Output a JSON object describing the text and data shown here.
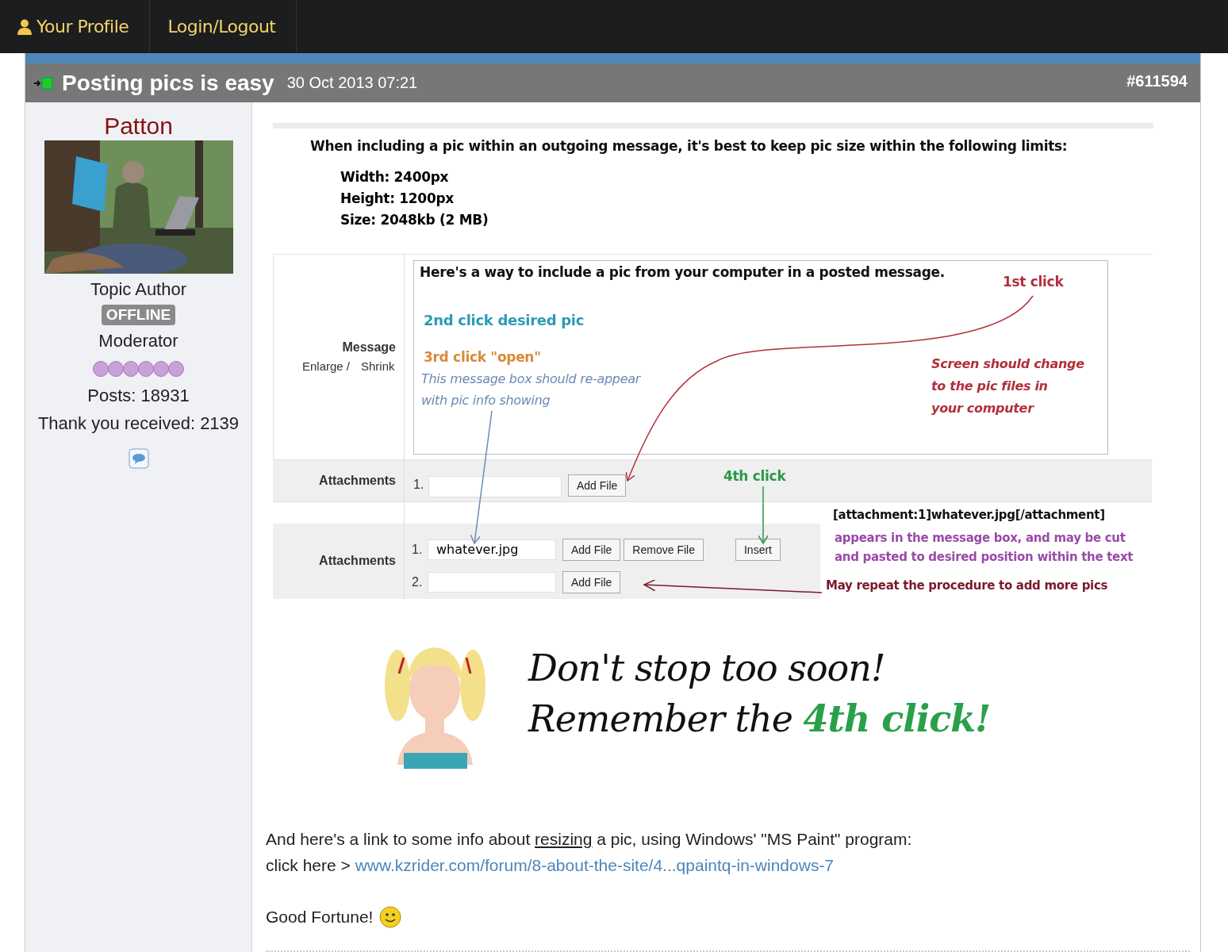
{
  "nav": {
    "items": [
      {
        "label": "Your Profile",
        "kind": "profile"
      },
      {
        "label": "Login/Logout",
        "kind": "link"
      }
    ]
  },
  "post": {
    "title": "Posting pics is easy",
    "date": "30 Oct 2013 07:21",
    "number": "#611594"
  },
  "author": {
    "name": "Patton",
    "role": "Topic Author",
    "status": "OFFLINE",
    "online": false,
    "rank": "Moderator",
    "stars": 6,
    "posts": "Posts: 18931",
    "thanks": "Thank you received: 2139"
  },
  "tutorial": {
    "intro": "When including a pic within an outgoing message, it's best to keep pic size within the following limits:",
    "limits": [
      "Width: 2400px",
      "Height: 1200px",
      "Size: 2048kb (2 MB)"
    ],
    "message_label": "Message",
    "enlarge": "Enlarge /",
    "shrink": "Shrink",
    "message_text": "Here's a way to include a pic from your computer in a posted message.",
    "step1": "1st click",
    "step2": "2nd click desired pic",
    "step3": "3rd click \"open\"",
    "reappear": [
      "This message box should re-appear",
      "with pic info showing"
    ],
    "screen_note": [
      "Screen should change",
      "to the pic files in",
      "your computer"
    ],
    "attachments_label": "Attachments",
    "step4": "4th click",
    "first_form": {
      "number": "1.",
      "button": "Add File"
    },
    "second_form": {
      "label": "Attachments",
      "rows": [
        {
          "number": "1.",
          "value": "whatever.jpg",
          "buttons": [
            "Add File",
            "Remove File",
            "Insert"
          ]
        },
        {
          "number": "2.",
          "buttons": [
            "Add File"
          ]
        }
      ]
    },
    "code": "[attachment:1]whatever.jpg[/attachment]",
    "code_note": [
      "appears in the message box, and may be cut",
      "and pasted to desired position within the text"
    ],
    "repeat_note": "May repeat the procedure to add more pics"
  },
  "cartoon": {
    "line1": "Don't stop too soon!",
    "line2": "Remember the",
    "highlight": "4th click!"
  },
  "body": {
    "before": "And here's a link to some info about",
    "link": "resizing",
    "after": "a pic, using Windows' \"MS Paint\" program:",
    "click_here": "click here >",
    "url": "www.kzrider.com/forum/8-about-the-site/4...qpaintq-in-windows-7",
    "closing": "Good Fortune!"
  }
}
